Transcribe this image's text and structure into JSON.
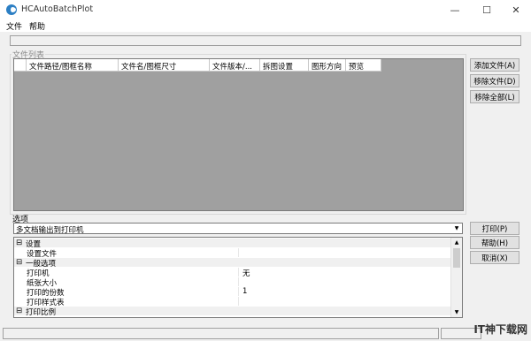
{
  "window": {
    "title": "HCAutoBatchPlot",
    "minimize_glyph": "—",
    "maximize_glyph": "☐",
    "close_glyph": "✕"
  },
  "menu": [
    "文件",
    "帮助"
  ],
  "file_list": {
    "group_label": "文件列表",
    "columns": [
      "",
      "文件路径/图框名称",
      "文件名/图框尺寸",
      "文件版本/...",
      "拆图设置",
      "图形方向",
      "预览"
    ],
    "background_color": "#a0a0a0"
  },
  "file_buttons": {
    "add": "添加文件(A)",
    "remove": "移除文件(D)",
    "remove_all": "移除全部(L)"
  },
  "options": {
    "label": "选项",
    "mode_select_value": "多文档输出到打印机",
    "properties": [
      {
        "kind": "category",
        "toggle": "⊟",
        "name": "设置"
      },
      {
        "kind": "item",
        "name": "设置文件",
        "value": ""
      },
      {
        "kind": "category",
        "toggle": "⊟",
        "name": "一般选项"
      },
      {
        "kind": "item",
        "name": "打印机",
        "value": "无"
      },
      {
        "kind": "item",
        "name": "纸张大小",
        "value": ""
      },
      {
        "kind": "item",
        "name": "打印的份数",
        "value": "1"
      },
      {
        "kind": "item",
        "name": "打印样式表",
        "value": ""
      },
      {
        "kind": "category",
        "toggle": "⊟",
        "name": "打印比例"
      }
    ]
  },
  "action_buttons": {
    "print": "打印(P)",
    "help": "帮助(H)",
    "cancel": "取消(X)"
  },
  "watermark": "IT神下载网"
}
